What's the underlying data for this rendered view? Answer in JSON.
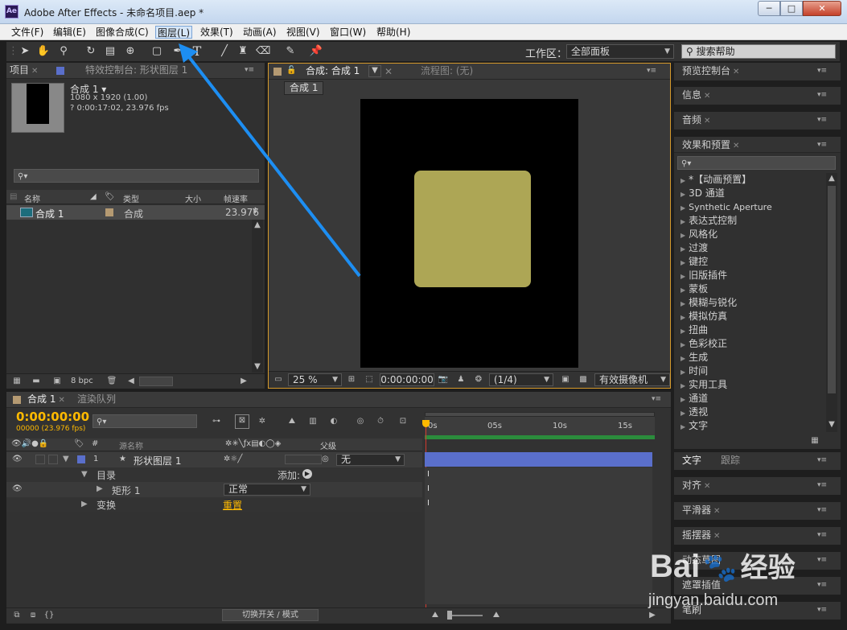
{
  "window": {
    "app_icon": "Ae",
    "title": "Adobe After Effects - 未命名项目.aep *",
    "controls": {
      "minimize": "─",
      "maximize": "□",
      "close": "✕"
    }
  },
  "menu": [
    "文件(F)",
    "编辑(E)",
    "图像合成(C)",
    "图层(L)",
    "效果(T)",
    "动画(A)",
    "视图(V)",
    "窗口(W)",
    "帮助(H)"
  ],
  "menu_active_index": 3,
  "toolbar": {
    "workspace_label": "工作区：",
    "workspace_value": "全部面板",
    "search_placeholder": "搜索帮助",
    "text_tool": "T"
  },
  "project_panel": {
    "tab_project": "项目",
    "tab_effects_controls": "特效控制台: 形状图层 1",
    "comp_name": "合成 1 ▾",
    "comp_size": "1080 x 1920 (1.00)",
    "comp_duration": "? 0:00:17:02, 23.976 fps",
    "columns": [
      "名称",
      "类型",
      "大小",
      "帧速率"
    ],
    "rows": [
      {
        "name": "合成 1",
        "type": "合成",
        "size": "",
        "fps": "23.976"
      }
    ],
    "bpc": "8 bpc"
  },
  "comp_viewer": {
    "tab_comp": "合成: 合成 1",
    "tab_flowchart": "流程图: (无)",
    "breadcrumb": "合成 1",
    "zoom": "25 %",
    "timecode": "0:00:00:00",
    "resolution": "(1/4)",
    "camera": "有效摄像机",
    "shape_color": "#ada655"
  },
  "right_panels": {
    "preview": "预览控制台",
    "info": "信息",
    "audio": "音频",
    "effects_presets": "效果和预置",
    "effects_items": [
      "*【动画预置】",
      "3D 通道",
      "Synthetic Aperture",
      "表达式控制",
      "风格化",
      "过渡",
      "键控",
      "旧版插件",
      "蒙板",
      "模糊与锐化",
      "模拟仿真",
      "扭曲",
      "色彩校正",
      "生成",
      "时间",
      "实用工具",
      "通道",
      "透视",
      "文字"
    ],
    "text": "文字",
    "paragraph": "跟踪",
    "align": "对齐",
    "smoother": "平滑器",
    "wiggler": "摇摆器",
    "motion_sketch": "动态草图",
    "mask_interp": "遮罩插值",
    "brush": "笔刷"
  },
  "timeline": {
    "tab_comp": "合成 1",
    "tab_render": "渲染队列",
    "timecode": "0:00:00:00",
    "frame_info": "00000 (23.976 fps)",
    "col_num": "#",
    "col_source": "源名称",
    "col_parent": "父级",
    "ruler": [
      "0s",
      "05s",
      "10s",
      "15s"
    ],
    "layer": {
      "num": "1",
      "name": "形状图层 1",
      "parent": "无"
    },
    "contents": "目录",
    "add": "添加:",
    "rect": "矩形 1",
    "blend": "正常",
    "transform": "变换",
    "reset": "重置",
    "toggle_mode": "切换开关 / 模式",
    "layer_color": "#5a6fcb",
    "accent_color": "#ffba00"
  },
  "watermark": {
    "brand": "Bai",
    "brand_cn": "经验",
    "url": "jingyan.baidu.com"
  }
}
